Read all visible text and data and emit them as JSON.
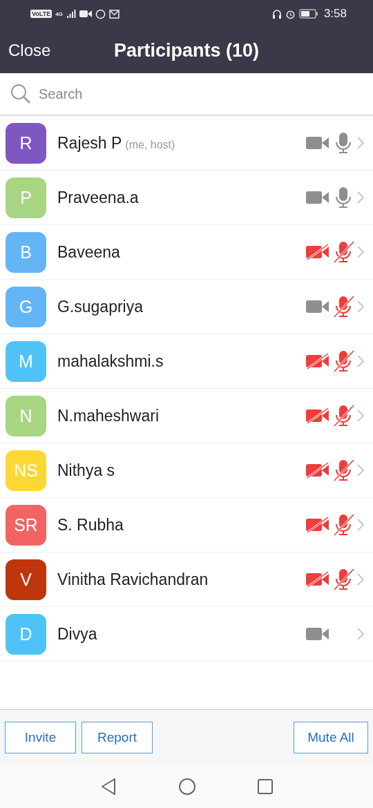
{
  "status_bar": {
    "network_badge": "VoLTE",
    "network_type": "4G",
    "time": "3:58"
  },
  "header": {
    "close": "Close",
    "title": "Participants (10)"
  },
  "search": {
    "placeholder": "Search"
  },
  "participants": [
    {
      "initials": "R",
      "color": "#7e57c2",
      "name": "Rajesh P",
      "note": "(me, host)",
      "video_on": true,
      "mic_on": true
    },
    {
      "initials": "P",
      "color": "#a8d582",
      "name": "Praveena.a",
      "video_on": true,
      "mic_on": true
    },
    {
      "initials": "B",
      "color": "#64b5f6",
      "name": "Baveena",
      "video_on": false,
      "mic_on": false
    },
    {
      "initials": "G",
      "color": "#64b5f6",
      "name": "G.sugapriya",
      "video_on": true,
      "mic_on": false
    },
    {
      "initials": "M",
      "color": "#4fc3f7",
      "name": "mahalakshmi.s",
      "video_on": false,
      "mic_on": false
    },
    {
      "initials": "N",
      "color": "#a8d582",
      "name": "N.maheshwari",
      "video_on": false,
      "mic_on": false
    },
    {
      "initials": "NS",
      "color": "#fdd835",
      "name": "Nithya s",
      "video_on": false,
      "mic_on": false
    },
    {
      "initials": "SR",
      "color": "#f26464",
      "name": "S. Rubha",
      "video_on": false,
      "mic_on": false
    },
    {
      "initials": "V",
      "color": "#bf360c",
      "name": "Vinitha Ravichandran",
      "video_on": false,
      "mic_on": false
    },
    {
      "initials": "D",
      "color": "#4fc3f7",
      "name": "Divya",
      "video_on": true
    }
  ],
  "footer": {
    "buttons_left": [
      "Invite",
      "Report"
    ],
    "button_right": "Mute All"
  }
}
